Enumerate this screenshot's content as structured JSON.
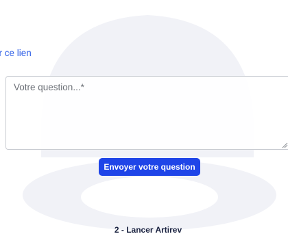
{
  "link": {
    "text": "ur ce lien"
  },
  "question_form": {
    "placeholder": "Votre question...*",
    "submit_label": "Envoyer votre question"
  },
  "step": {
    "title": "2 - Lancer Artirev"
  },
  "colors": {
    "link": "#2f5fe6",
    "button": "#1f45e8",
    "heading": "#1a2240",
    "watermark": "#eef0f6"
  },
  "icons": {
    "background": "watermark-logo",
    "grip": "resize-grip-icon"
  }
}
